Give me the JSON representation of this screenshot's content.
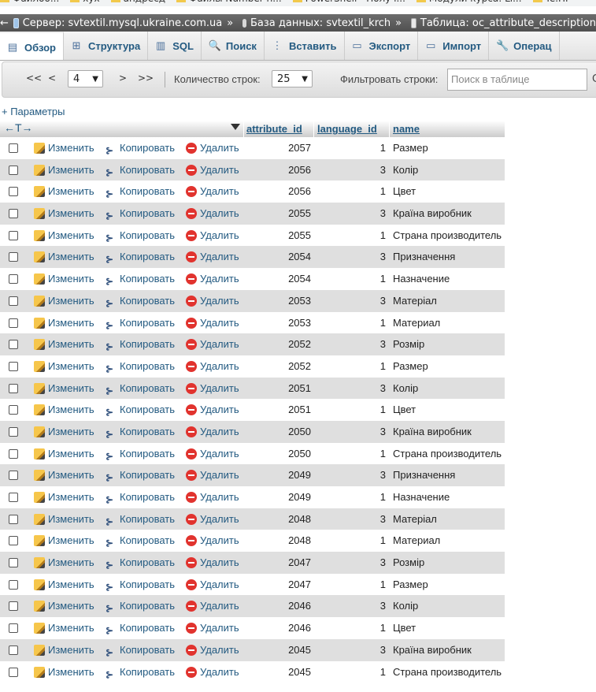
{
  "bookmarks": [
    "Файлоо...",
    "хух",
    "андрeсд",
    "Файлы Number н...",
    "PowerShell - Получ...",
    "Модули курса: Li...",
    "Te.ПР"
  ],
  "breadcrumb": {
    "back": "←",
    "server": "Сервер: svtextil.mysql.ukraine.com.ua",
    "database": "База данных: svtextil_krch",
    "table": "Таблица: oc_attribute_description",
    "separator": "»"
  },
  "tabs": [
    {
      "label": "Обзор",
      "icon": "browse-icon",
      "glyph": "▤"
    },
    {
      "label": "Структура",
      "icon": "structure-icon",
      "glyph": "⊞"
    },
    {
      "label": "SQL",
      "icon": "sql-icon",
      "glyph": "▥"
    },
    {
      "label": "Поиск",
      "icon": "search-icon",
      "glyph": "🔍"
    },
    {
      "label": "Вставить",
      "icon": "insert-icon",
      "glyph": "⋮"
    },
    {
      "label": "Экспорт",
      "icon": "export-icon",
      "glyph": "▭"
    },
    {
      "label": "Импорт",
      "icon": "import-icon",
      "glyph": "▭"
    },
    {
      "label": "Операц",
      "icon": "wrench-icon",
      "glyph": "🔧"
    }
  ],
  "nav": {
    "first": "<<",
    "prev": "<",
    "page": "4",
    "next": ">",
    "last": ">>",
    "rows_label": "Количество строк:",
    "rows_value": "25",
    "filter_label": "Фильтровать строки:",
    "filter_placeholder": "Поиск в таблице",
    "tail": "С"
  },
  "params_link": "+ Параметры",
  "table": {
    "header_arrows": "←T→",
    "columns": [
      "attribute_id",
      "language_id",
      "name"
    ],
    "actions": {
      "edit": "Изменить",
      "copy": "Копировать",
      "delete": "Удалить"
    },
    "rows": [
      {
        "attribute_id": "2057",
        "language_id": "1",
        "name": "Размер"
      },
      {
        "attribute_id": "2056",
        "language_id": "3",
        "name": "Колір"
      },
      {
        "attribute_id": "2056",
        "language_id": "1",
        "name": "Цвет"
      },
      {
        "attribute_id": "2055",
        "language_id": "3",
        "name": "Країна виробник"
      },
      {
        "attribute_id": "2055",
        "language_id": "1",
        "name": "Страна производитель"
      },
      {
        "attribute_id": "2054",
        "language_id": "3",
        "name": "Призначення"
      },
      {
        "attribute_id": "2054",
        "language_id": "1",
        "name": "Назначение"
      },
      {
        "attribute_id": "2053",
        "language_id": "3",
        "name": "Матеріал"
      },
      {
        "attribute_id": "2053",
        "language_id": "1",
        "name": "Материал"
      },
      {
        "attribute_id": "2052",
        "language_id": "3",
        "name": "Розмір"
      },
      {
        "attribute_id": "2052",
        "language_id": "1",
        "name": "Размер"
      },
      {
        "attribute_id": "2051",
        "language_id": "3",
        "name": "Колір"
      },
      {
        "attribute_id": "2051",
        "language_id": "1",
        "name": "Цвет"
      },
      {
        "attribute_id": "2050",
        "language_id": "3",
        "name": "Країна виробник"
      },
      {
        "attribute_id": "2050",
        "language_id": "1",
        "name": "Страна производитель"
      },
      {
        "attribute_id": "2049",
        "language_id": "3",
        "name": "Призначення"
      },
      {
        "attribute_id": "2049",
        "language_id": "1",
        "name": "Назначение"
      },
      {
        "attribute_id": "2048",
        "language_id": "3",
        "name": "Матеріал"
      },
      {
        "attribute_id": "2048",
        "language_id": "1",
        "name": "Материал"
      },
      {
        "attribute_id": "2047",
        "language_id": "3",
        "name": "Розмір"
      },
      {
        "attribute_id": "2047",
        "language_id": "1",
        "name": "Размер"
      },
      {
        "attribute_id": "2046",
        "language_id": "3",
        "name": "Колір"
      },
      {
        "attribute_id": "2046",
        "language_id": "1",
        "name": "Цвет"
      },
      {
        "attribute_id": "2045",
        "language_id": "3",
        "name": "Країна виробник"
      },
      {
        "attribute_id": "2045",
        "language_id": "1",
        "name": "Страна производитель"
      }
    ]
  },
  "colors": {
    "link": "#235a81",
    "row_even": "#dfdfdf",
    "breadcrumb_bg": "#5f5f5f",
    "delete_icon": "#e1332e"
  }
}
